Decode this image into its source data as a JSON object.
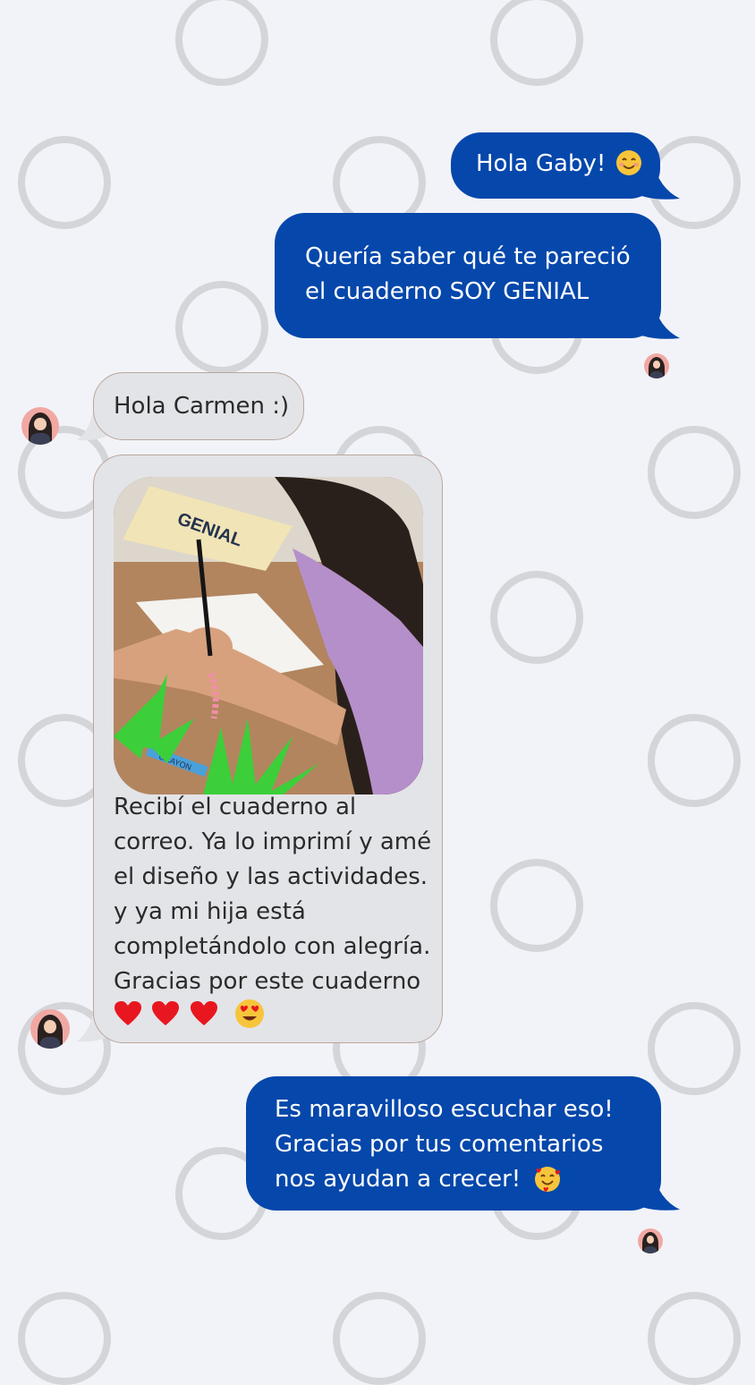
{
  "colors": {
    "background": "#f2f3f8",
    "sent_bubble": "#0547ab",
    "received_bubble": "#e3e4e8",
    "ring": "#d4d5d9"
  },
  "messages": [
    {
      "id": "m1",
      "direction": "sent",
      "text": "Hola Gaby!",
      "emoji": "smiling-face"
    },
    {
      "id": "m2",
      "direction": "sent",
      "lines": [
        "Quería saber qué te pareció",
        "el cuaderno SOY GENIAL"
      ]
    },
    {
      "id": "m3",
      "direction": "received",
      "text": "Hola Carmen :)"
    },
    {
      "id": "m4",
      "direction": "received",
      "image": "photo-girl-writing-notebook",
      "lines": [
        "Recibí el cuaderno al",
        "correo. Ya lo imprimí y amé",
        "el diseño y las actividades.",
        "y ya mi hija está",
        "completándolo con alegría.",
        "Gracias por este cuaderno"
      ],
      "emojis": [
        "red-heart",
        "red-heart",
        "red-heart",
        "heart-eyes-face"
      ]
    },
    {
      "id": "m5",
      "direction": "sent",
      "lines": [
        "Es maravilloso escuchar eso!",
        "Gracias por tus comentarios",
        "nos ayudan a crecer!"
      ],
      "emoji": "smiling-face-with-hearts"
    }
  ],
  "photo": {
    "notebook_cover_text": "GENIAL",
    "crayon_text": "CRAYON"
  }
}
